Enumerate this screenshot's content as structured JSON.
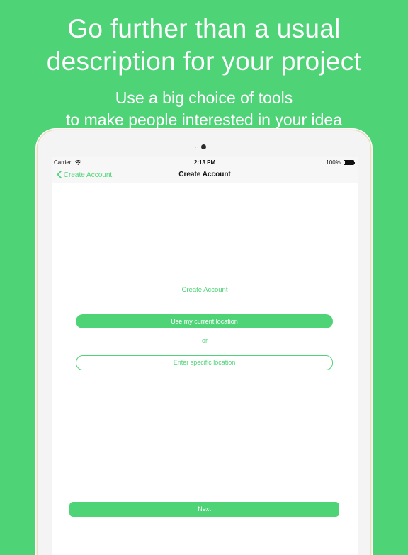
{
  "promo": {
    "headline_line1": "Go further than a usual",
    "headline_line2": "description for your project",
    "sub_line1": "Use a big choice of tools",
    "sub_line2": "to make people interested in your idea"
  },
  "status_bar": {
    "carrier": "Carrier",
    "time": "2:13 PM",
    "battery": "100%"
  },
  "nav": {
    "back_label": "Create Account",
    "title": "Create Account"
  },
  "content": {
    "section_title": "Create Account",
    "use_location_label": "Use my current location",
    "or_label": "or",
    "specific_location_label": "Enter specific location",
    "next_label": "Next"
  },
  "colors": {
    "accent": "#4fd377",
    "background": "#4fd377"
  },
  "icons": {
    "wifi": "wifi-icon",
    "battery": "battery-icon",
    "back": "chevron-left-icon",
    "camera": "camera-icon"
  }
}
